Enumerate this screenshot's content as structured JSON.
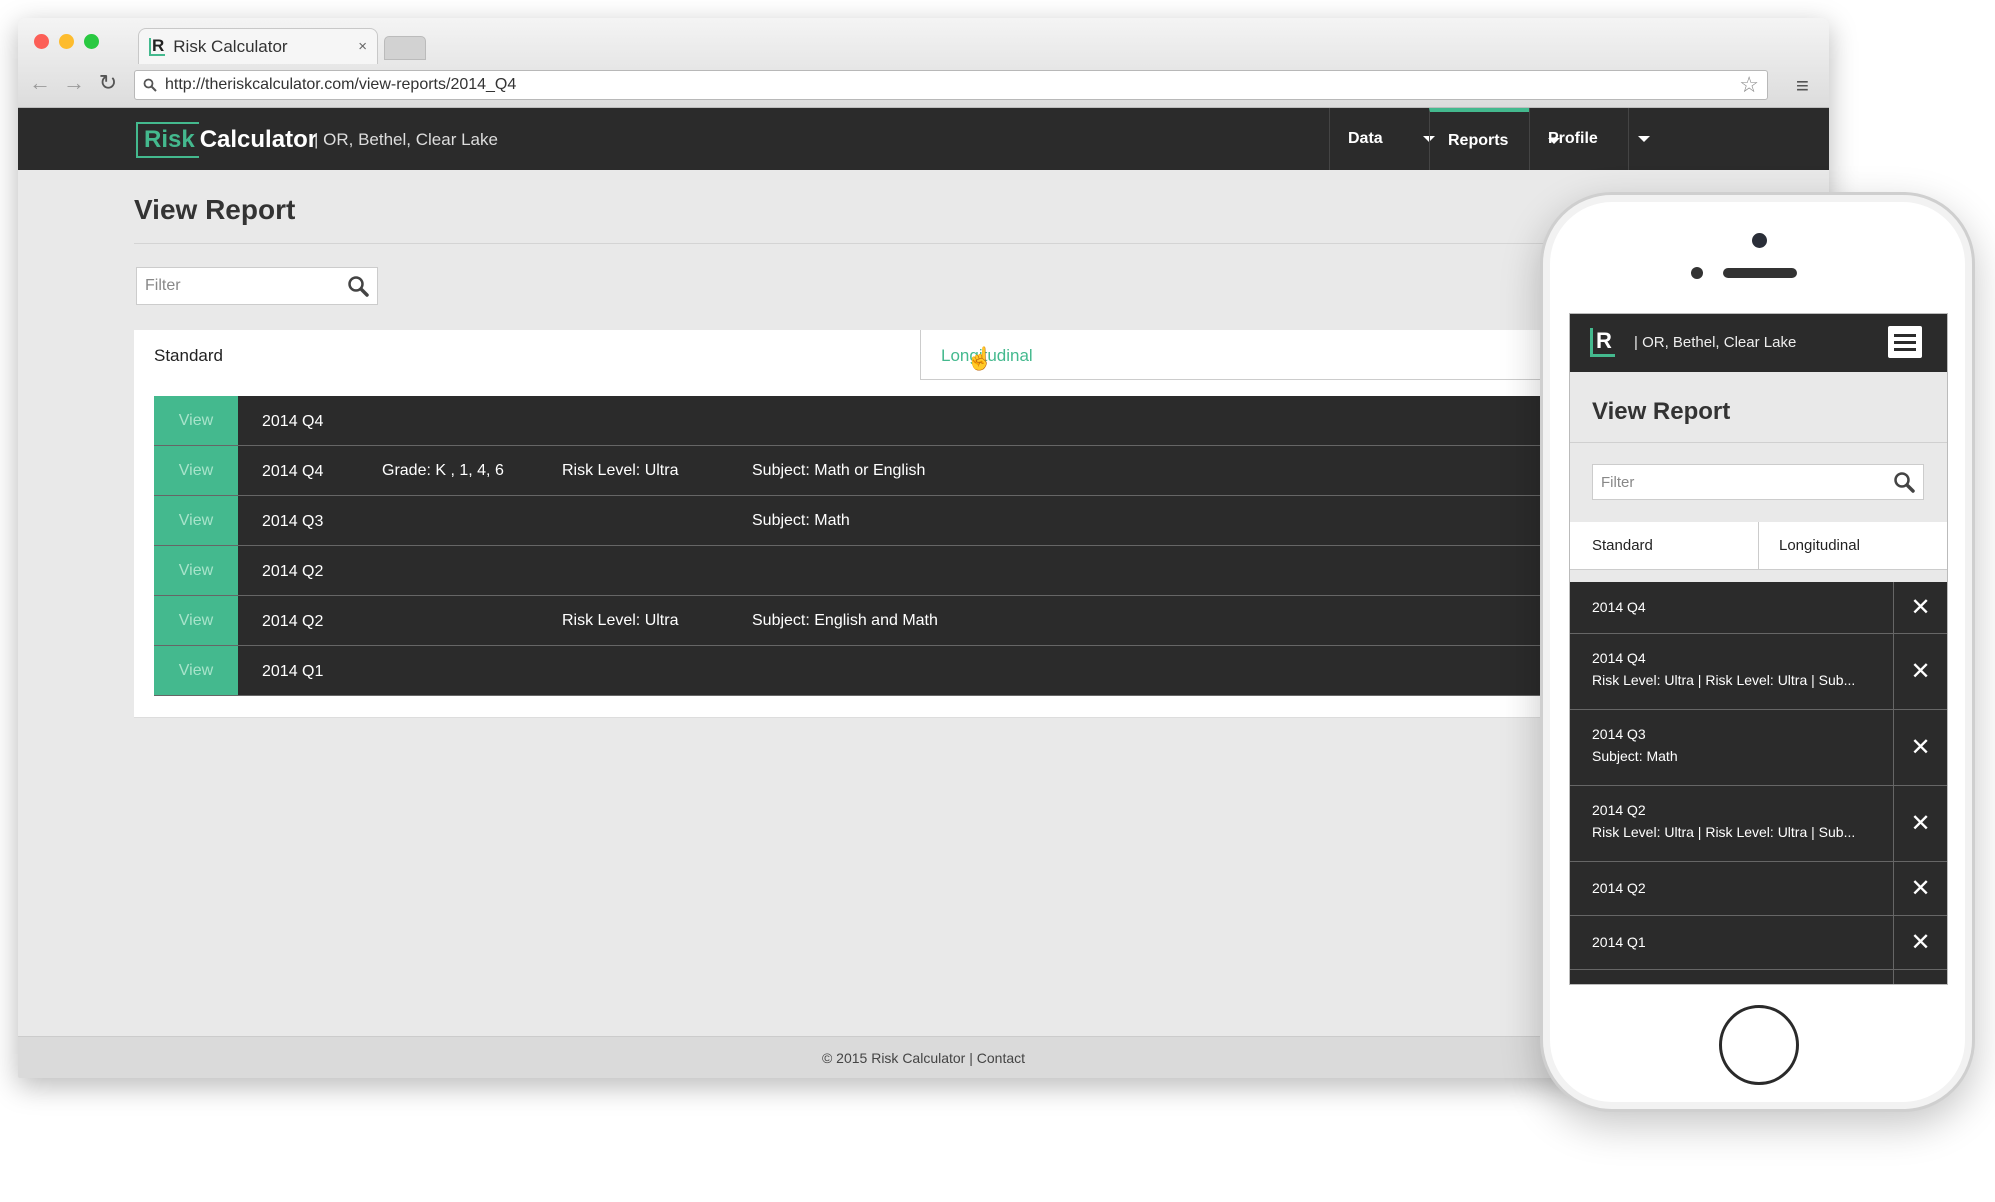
{
  "browser": {
    "tab_title": "Risk Calculator",
    "tab_logo": "R",
    "tab_close": "×",
    "url": "http://theriskcalculator.com/view-reports/2014_Q4"
  },
  "header": {
    "logo_risk": "Risk",
    "logo_calc": "Calculator",
    "location": "|  OR, Bethel, Clear Lake",
    "nav": [
      {
        "label": "Data"
      },
      {
        "label": "Reports",
        "active": true
      },
      {
        "label": "Profile"
      }
    ]
  },
  "main": {
    "title": "View Report",
    "filter_placeholder": "Filter",
    "tabs": {
      "standard": "Standard",
      "longitudinal": "Longitudinal"
    },
    "view_label": "View",
    "rows": [
      {
        "period": "2014 Q4",
        "grade": "",
        "risk": "",
        "subject": ""
      },
      {
        "period": "2014 Q4",
        "grade": "Grade: K , 1, 4, 6",
        "risk": "Risk Level: Ultra",
        "subject": "Subject: Math  or  English"
      },
      {
        "period": "2014 Q3",
        "grade": "",
        "risk": "",
        "subject": "Subject: Math"
      },
      {
        "period": "2014 Q2",
        "grade": "",
        "risk": "",
        "subject": ""
      },
      {
        "period": "2014 Q2",
        "grade": "",
        "risk": "Risk Level: Ultra",
        "subject": "Subject: English and Math"
      },
      {
        "period": "2014 Q1",
        "grade": "",
        "risk": "",
        "subject": ""
      }
    ]
  },
  "footer": {
    "text": "© 2015 Risk Calculator  |  Contact"
  },
  "mobile": {
    "logo": "R",
    "location": "|  OR, Bethel, Clear Lake",
    "title": "View Report",
    "filter_placeholder": "Filter",
    "tab_standard": "Standard",
    "tab_longitudinal": "Longitudinal",
    "rows": [
      {
        "line1": "2014 Q4",
        "line2": ""
      },
      {
        "line1": "2014 Q4",
        "line2": "Risk Level: Ultra  | Risk Level: Ultra  |  Sub..."
      },
      {
        "line1": "2014 Q3",
        "line2": "Subject: Math"
      },
      {
        "line1": "2014 Q2",
        "line2": "Risk Level: Ultra  | Risk Level: Ultra  |  Sub..."
      },
      {
        "line1": "2014 Q2",
        "line2": ""
      },
      {
        "line1": "2014 Q1",
        "line2": ""
      }
    ]
  },
  "colors": {
    "accent": "#44b98e",
    "dark": "#2b2b2b"
  }
}
